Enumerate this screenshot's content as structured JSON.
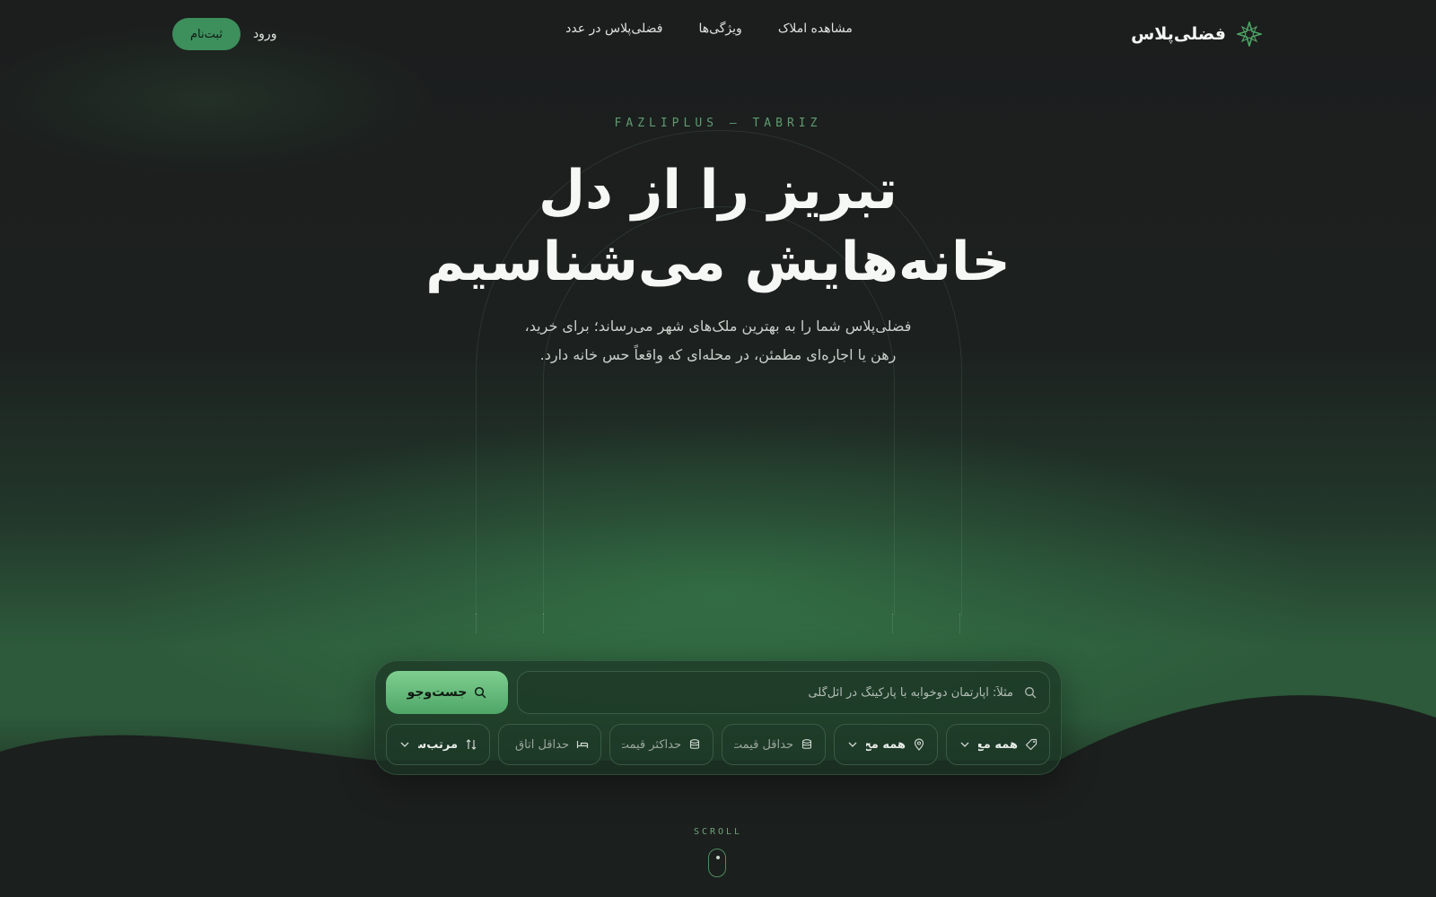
{
  "nav": {
    "brand": "فضلی‌پلاس",
    "links": [
      "مشاهده املاک",
      "ویژگی‌ها",
      "فضلی‌پلاس در عدد"
    ],
    "login_label": "ورود",
    "signup_label": "ثبت‌نام"
  },
  "hero": {
    "kicker": "FAZLIPLUS — TABRIZ",
    "title_line1": "تبریز را از دل",
    "title_line2": "خانه‌هایش می‌شناسیم",
    "subtitle_line1": "فضلی‌پلاس شما را به بهترین ملک‌های شهر می‌رساند؛ برای خرید،",
    "subtitle_line2": "رهن یا اجاره‌ای مطمئن، در محله‌ای که واقعاً حس خانه دارد."
  },
  "search": {
    "placeholder": "مثلاً: آپارتمان دوخوابه با پارکینگ در ائل‌گلی",
    "button_label": "جست‌وجو",
    "filters": [
      {
        "label": "همه مع",
        "icon": "tag-icon",
        "dropdown": true
      },
      {
        "label": "همه مح",
        "icon": "location-pin-icon",
        "dropdown": true
      },
      {
        "label": "حداقل قیمت",
        "icon": "coins-icon",
        "dropdown": false
      },
      {
        "label": "حداکثر قیمت",
        "icon": "coins-icon",
        "dropdown": false
      },
      {
        "label": "حداقل اتاق",
        "icon": "bed-icon",
        "dropdown": false
      },
      {
        "label": "مرتب‌سا",
        "icon": "sort-icon",
        "dropdown": true
      }
    ]
  },
  "scroll": {
    "label": "SCROLL"
  },
  "colors": {
    "accent": "#4fa667",
    "background": "#191c1b",
    "accent_dark": "#3d8f5c"
  }
}
